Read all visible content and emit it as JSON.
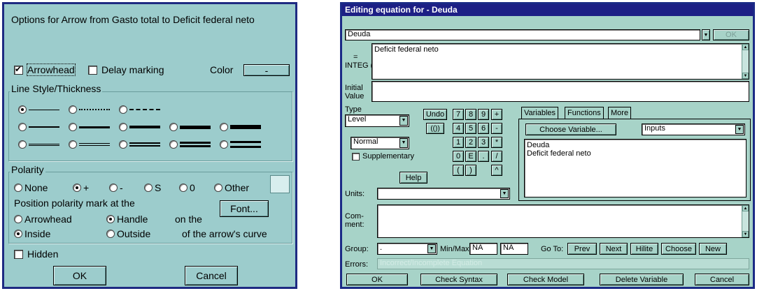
{
  "arrow_dialog": {
    "title": "Options for Arrow from Gasto total to Deficit federal neto",
    "arrowhead_label": "Arrowhead",
    "arrowhead_checked": true,
    "delay_marking_label": "Delay marking",
    "delay_marking_checked": false,
    "color_label": "Color",
    "color_button": "-",
    "line_style_label": "Line Style/Thickness",
    "polarity_label": "Polarity",
    "polarity_options": [
      "None",
      "+",
      "-",
      "S",
      "0",
      "Other"
    ],
    "polarity_selected": "+",
    "position_label": "Position polarity mark at the",
    "pos_arrowhead": "Arrowhead",
    "pos_handle": "Handle",
    "pos_on_the": "on the",
    "pos_inside": "Inside",
    "pos_outside": "Outside",
    "pos_curve": "of the arrow's curve",
    "font_button": "Font...",
    "hidden_label": "Hidden",
    "hidden_checked": false,
    "ok_button": "OK",
    "cancel_button": "Cancel"
  },
  "equation_dialog": {
    "title": "Editing equation for - Deuda",
    "variable_name": "Deuda",
    "ok_top": "OK",
    "equals_label": "=",
    "integ_label": "INTEG (",
    "equation_text": "Deficit federal neto",
    "initial_label": "Initial",
    "value_label": "Value",
    "initial_value": "",
    "type_label": "Type",
    "type_value": "Level",
    "subtype_value": "Normal",
    "supplementary_label": "Supplementary",
    "undo_button": "Undo",
    "paren_button": "(())",
    "keypad": [
      "7",
      "8",
      "9",
      "+",
      "4",
      "5",
      "6",
      "-",
      "1",
      "2",
      "3",
      "*",
      "0",
      "E",
      ".",
      "/",
      "(",
      ")",
      "",
      "^"
    ],
    "help_button": "Help",
    "tabs": [
      "Variables",
      "Functions",
      "More"
    ],
    "choose_variable_button": "Choose Variable...",
    "inputs_select": "Inputs",
    "variable_list": [
      "Deuda",
      "Deficit federal neto"
    ],
    "units_label": "Units:",
    "units_value": "",
    "comment_label_1": "Com-",
    "comment_label_2": "ment:",
    "comment_value": "",
    "group_label": "Group:",
    "group_value": ".",
    "minmax_label": "Min/Max",
    "min_value": "NA",
    "max_value": "NA",
    "goto_label": "Go To:",
    "nav_buttons": [
      "Prev",
      "Next",
      "Hilite",
      "Choose",
      "New"
    ],
    "errors_label": "Errors:",
    "errors_text": "Incorrect/Incomplete Equation",
    "bottom_buttons": [
      "OK",
      "Check Syntax",
      "Check Model",
      "Delete Variable",
      "Cancel"
    ]
  }
}
